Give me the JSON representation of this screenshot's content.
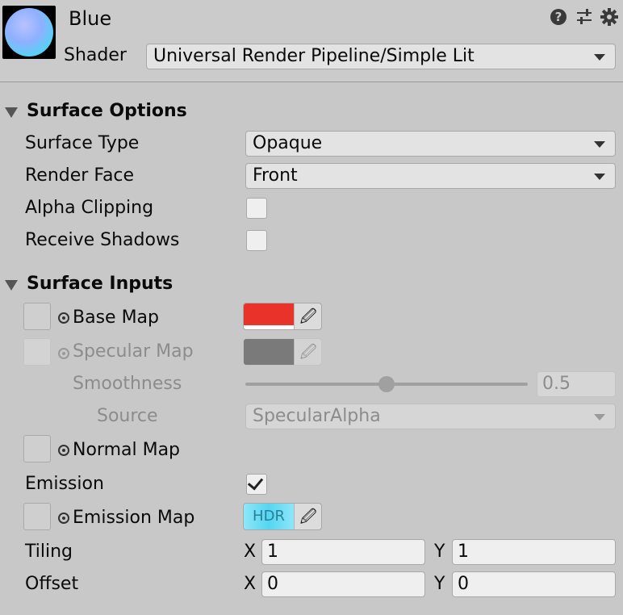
{
  "header": {
    "material_name": "Blue",
    "shader_label": "Shader",
    "shader_value": "Universal Render Pipeline/Simple Lit",
    "icons": [
      "help-icon",
      "presets-icon",
      "settings-gear-icon"
    ]
  },
  "surface_options": {
    "title": "Surface Options",
    "surface_type_label": "Surface Type",
    "surface_type_value": "Opaque",
    "render_face_label": "Render Face",
    "render_face_value": "Front",
    "alpha_clipping_label": "Alpha Clipping",
    "alpha_clipping_checked": false,
    "receive_shadows_label": "Receive Shadows",
    "receive_shadows_checked": false
  },
  "surface_inputs": {
    "title": "Surface Inputs",
    "base_map_label": "Base Map",
    "base_map_color": "#e8322a",
    "specular_map_label": "Specular Map",
    "specular_map_color": "#7a7a7a",
    "smoothness_label": "Smoothness",
    "smoothness_value": "0.5",
    "source_label": "Source",
    "source_value": "SpecularAlpha",
    "normal_map_label": "Normal Map",
    "emission_label": "Emission",
    "emission_checked": true,
    "emission_map_label": "Emission Map",
    "emission_hdr_label": "HDR",
    "emission_color": "#55d6f2",
    "tiling_label": "Tiling",
    "tiling_x_label": "X",
    "tiling_x": "1",
    "tiling_y_label": "Y",
    "tiling_y": "1",
    "offset_label": "Offset",
    "offset_x_label": "X",
    "offset_x": "0",
    "offset_y_label": "Y",
    "offset_y": "0"
  }
}
